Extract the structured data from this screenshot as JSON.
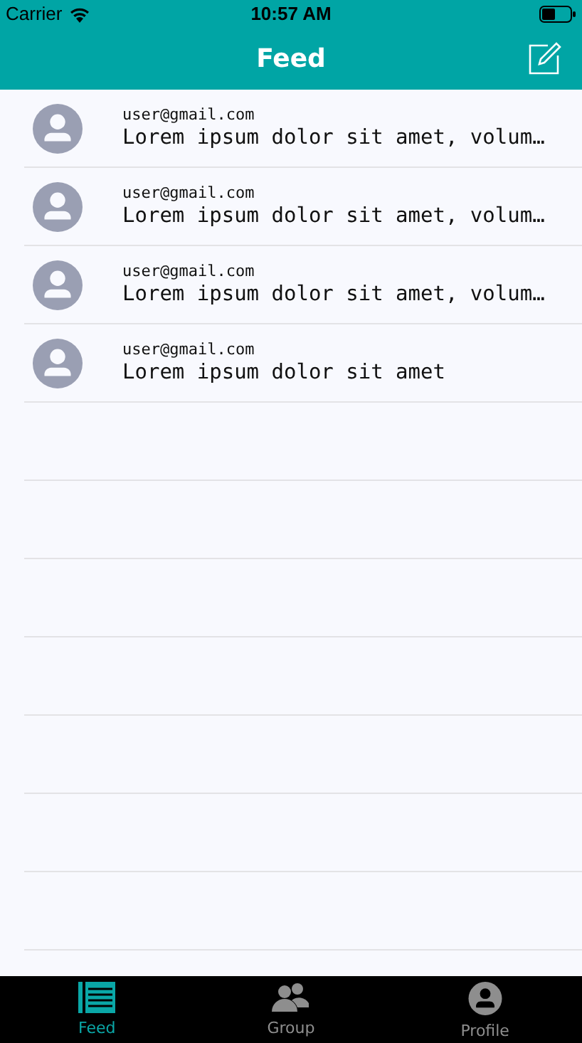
{
  "status_bar": {
    "carrier": "Carrier",
    "time": "10:57 AM"
  },
  "nav_bar": {
    "title": "Feed"
  },
  "posts": [
    {
      "author": "user@gmail.com",
      "text": "Lorem ipsum dolor sit amet, volum…"
    },
    {
      "author": "user@gmail.com",
      "text": "Lorem ipsum dolor sit amet, volum…"
    },
    {
      "author": "user@gmail.com",
      "text": "Lorem ipsum dolor sit amet, volum…"
    },
    {
      "author": "user@gmail.com",
      "text": "Lorem ipsum dolor sit amet"
    }
  ],
  "tabs": [
    {
      "kind": "feed",
      "label": "Feed",
      "selected": true
    },
    {
      "kind": "group",
      "label": "Group",
      "selected": false
    },
    {
      "kind": "profile",
      "label": "Profile",
      "selected": false
    }
  ]
}
